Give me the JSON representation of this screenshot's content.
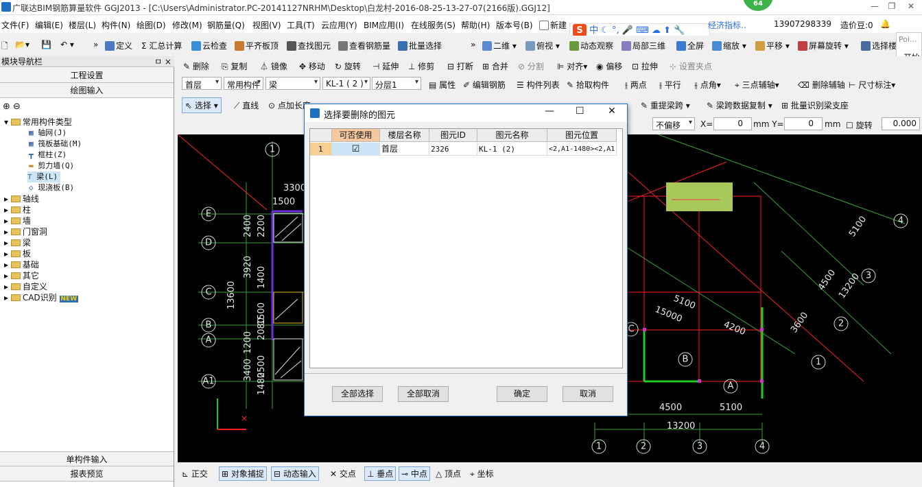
{
  "window": {
    "title": "广联达BIM钢筋算量软件 GGJ2013 - [C:\\Users\\Administrator.PC-20141127NRHM\\Desktop\\白龙村-2016-08-25-13-27-07(2166版).GGJ12]",
    "badge": "64"
  },
  "menu": [
    "文件(F)",
    "编辑(E)",
    "楼层(L)",
    "构件(N)",
    "绘图(D)",
    "修改(M)",
    "钢筋量(Q)",
    "视图(V)",
    "工具(T)",
    "云应用(Y)",
    "BIM应用(I)",
    "在线服务(S)",
    "帮助(H)",
    "版本号(B)"
  ],
  "menu_extra": {
    "new_label": "新建",
    "econ": "经济指标..",
    "phone": "13907298339",
    "price": "造价豆:0"
  },
  "toolbar1": [
    "定义",
    "汇总计算",
    "云检查",
    "平齐板顶",
    "查找图元",
    "查看钢筋量",
    "批量选择",
    "二维",
    "俯视",
    "动态观察",
    "局部三维",
    "全屏",
    "缩放",
    "平移",
    "屏幕旋转",
    "选择楼"
  ],
  "toolbar2": [
    "删除",
    "复制",
    "镜像",
    "移动",
    "旋转",
    "延伸",
    "修剪",
    "打断",
    "合并",
    "分割",
    "对齐",
    "偏移",
    "拉伸",
    "设置夹点"
  ],
  "toolbar3": {
    "floor": "首层",
    "category": "常用构件",
    "type": "梁",
    "component": "KL-1 ( 2 )",
    "layer": "分层1",
    "buttons": [
      "属性",
      "编辑钢筋",
      "构件列表",
      "拾取构件",
      "两点",
      "平行",
      "点角",
      "三点辅轴",
      "删除辅轴",
      "尺寸标注"
    ]
  },
  "toolbar4": {
    "select": "选择",
    "line": "直线",
    "point": "点加长度",
    "rebuild": "重提梁跨",
    "copy": "梁跨数据复制",
    "batch": "批量识别梁支座",
    "offset": "不偏移",
    "x_label": "X=",
    "x_val": "0",
    "y_label": "mm Y=",
    "y_val": "0",
    "mm": "mm",
    "rotate": "旋转",
    "rotate_val": "0.000"
  },
  "right_panel": {
    "poi": "Poi...",
    "start": "开始"
  },
  "nav": {
    "title": "模块导航栏",
    "pin": "ㅁ ×",
    "btn_project": "工程设置",
    "btn_draw": "绘图输入",
    "tree": [
      {
        "label": "常用构件类型",
        "level": 0,
        "open": true
      },
      {
        "label": "轴网(J)",
        "level": 1
      },
      {
        "label": "筏板基础(M)",
        "level": 1
      },
      {
        "label": "框柱(Z)",
        "level": 1
      },
      {
        "label": "剪力墙(Q)",
        "level": 1
      },
      {
        "label": "梁(L)",
        "level": 1,
        "selected": true
      },
      {
        "label": "现浇板(B)",
        "level": 1
      },
      {
        "label": "轴线",
        "level": 0
      },
      {
        "label": "柱",
        "level": 0
      },
      {
        "label": "墙",
        "level": 0
      },
      {
        "label": "门窗洞",
        "level": 0
      },
      {
        "label": "梁",
        "level": 0
      },
      {
        "label": "板",
        "level": 0
      },
      {
        "label": "基础",
        "level": 0
      },
      {
        "label": "其它",
        "level": 0
      },
      {
        "label": "自定义",
        "level": 0
      },
      {
        "label": "CAD识别",
        "level": 0,
        "new": "NEW"
      }
    ],
    "btn_single": "单构件输入",
    "btn_report": "报表预览"
  },
  "statusbar": [
    "正交",
    "对象捕捉",
    "动态输入",
    "交点",
    "垂点",
    "中点",
    "顶点",
    "坐标"
  ],
  "dialog": {
    "title": "选择要删除的图元",
    "columns": [
      "可否使用",
      "楼层名称",
      "图元ID",
      "图元名称",
      "图元位置"
    ],
    "rows": [
      {
        "no": "1",
        "checked": true,
        "floor": "首层",
        "id": "2326",
        "name": "KL-1 (2)",
        "pos": "<2,A1-1480><2,A1"
      }
    ],
    "btn_select_all": "全部选择",
    "btn_deselect_all": "全部取消",
    "btn_ok": "确定",
    "btn_cancel": "取消"
  },
  "cad": {
    "axis_left": [
      "E",
      "D",
      "C",
      "B",
      "A",
      "A1"
    ],
    "axis_bottom": [
      "1",
      "2",
      "3",
      "4"
    ],
    "axis_right": [
      "4",
      "3",
      "2",
      "1"
    ],
    "dims_left": [
      "3300",
      "1500",
      "2400",
      "2200",
      "3920",
      "1400",
      "13600",
      "1200",
      "1500",
      "2080",
      "3400",
      "1480",
      "2500"
    ],
    "dims_bottom": [
      "4500",
      "5100",
      "13200"
    ],
    "dims_diag": [
      "5100",
      "15000",
      "4200",
      "5100",
      "4500",
      "13200",
      "3600"
    ],
    "labels": [
      "C",
      "B",
      "A"
    ]
  }
}
